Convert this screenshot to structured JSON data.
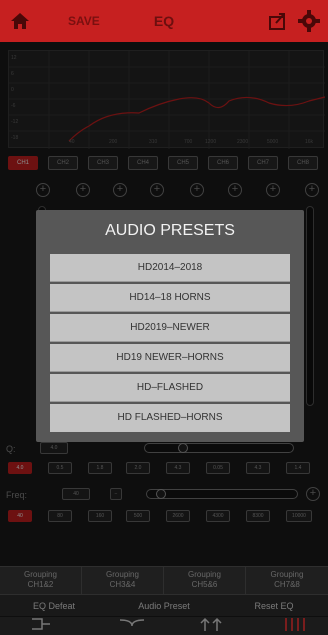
{
  "header": {
    "save_label": "SAVE",
    "title": "EQ"
  },
  "graph": {
    "y_labels": [
      "12",
      "6",
      "0",
      "-6",
      "-12",
      "-18"
    ],
    "x_labels": [
      "40",
      "200",
      "310",
      "700",
      "1200",
      "2300",
      "5000",
      "16k"
    ]
  },
  "channels": [
    "CH1",
    "CH2",
    "CH3",
    "CH4",
    "CH5",
    "CH6",
    "CH7",
    "CH8"
  ],
  "modal": {
    "title": "AUDIO PRESETS",
    "presets": [
      "HD2014–2018",
      "HD14–18 HORNS",
      "HD2019–NEWER",
      "HD19 NEWER–HORNS",
      "HD–FLASHED",
      "HD FLASHED–HORNS"
    ]
  },
  "q_row": {
    "label": "Q:",
    "value": "4.0"
  },
  "q_values": [
    "4.0",
    "0.5",
    "1.8",
    "2.0",
    "4.3",
    "0.05",
    "4.3",
    "1.4"
  ],
  "freq_row": {
    "label": "Freq:",
    "value": "40"
  },
  "freq_values": [
    "40",
    "80",
    "160",
    "500",
    "2600",
    "4300",
    "8300",
    "10000"
  ],
  "grouping": [
    "Grouping\nCH1&2",
    "Grouping\nCH3&4",
    "Grouping\nCH5&6",
    "Grouping\nCH7&8"
  ],
  "actions": {
    "eq_defeat": "EQ Defeat",
    "audio_preset": "Audio Preset",
    "reset_eq": "Reset EQ"
  },
  "bottom_nav": [
    "SUMMING",
    "CROSSOVER",
    "DelayGain",
    ""
  ],
  "colors": {
    "accent": "#c62020",
    "modal_bg": "#575757",
    "preset_bg": "#c4c4c4"
  }
}
